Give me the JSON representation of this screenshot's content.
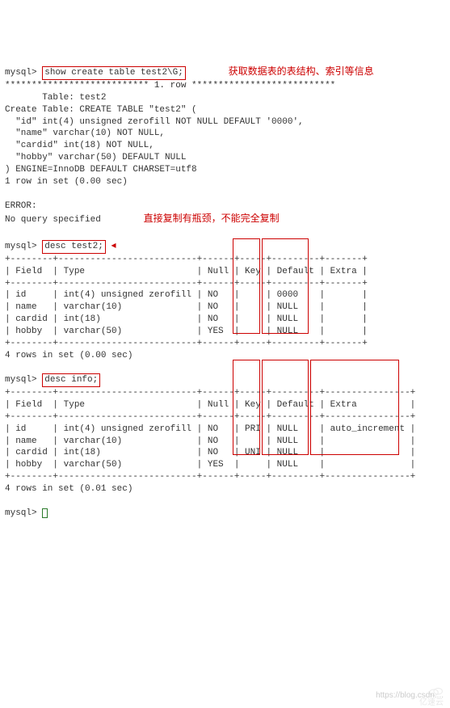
{
  "prompt": "mysql>",
  "cmd1": "show create table test2\\G;",
  "anno1": "获取数据表的表结构、索引等信息",
  "row_divider": "*************************** 1. row ***************************",
  "create": {
    "table_label": "       Table: test2",
    "create_label": "Create Table: CREATE TABLE \"test2\" (",
    "col_id": "  \"id\" int(4) unsigned zerofill NOT NULL DEFAULT '0000',",
    "col_name": "  \"name\" varchar(10) NOT NULL,",
    "col_cardid": "  \"cardid\" int(18) NOT NULL,",
    "col_hobby": "  \"hobby\" varchar(50) DEFAULT NULL",
    "engine": ") ENGINE=InnoDB DEFAULT CHARSET=utf8",
    "rows": "1 row in set (0.00 sec)"
  },
  "error_label": "ERROR:",
  "error_msg": "No query specified",
  "anno2": "直接复制有瓶颈，不能完全复制",
  "cmd2": "desc test2;",
  "table1": {
    "sep": "+--------+--------------------------+------+-----+---------+-------+",
    "head": "| Field  | Type                     | Null | Key | Default | Extra |",
    "r1": "| id     | int(4) unsigned zerofill | NO   |     | 0000    |       |",
    "r2": "| name   | varchar(10)              | NO   |     | NULL    |       |",
    "r3": "| cardid | int(18)                  | NO   |     | NULL    |       |",
    "r4": "| hobby  | varchar(50)              | YES  |     | NULL    |       |",
    "summary": "4 rows in set (0.00 sec)"
  },
  "cmd3": "desc info;",
  "table2": {
    "sep": "+--------+--------------------------+------+-----+---------+----------------+",
    "head": "| Field  | Type                     | Null | Key | Default | Extra          |",
    "r1": "| id     | int(4) unsigned zerofill | NO   | PRI | NULL    | auto_increment |",
    "r2": "| name   | varchar(10)              | NO   |     | NULL    |                |",
    "r3": "| cardid | int(18)                  | NO   | UNI | NULL    |                |",
    "r4": "| hobby  | varchar(50)              | YES  |     | NULL    |                |",
    "summary": "4 rows in set (0.01 sec)"
  },
  "watermark": "https://blog.csdn....",
  "logo_text": "亿速云"
}
